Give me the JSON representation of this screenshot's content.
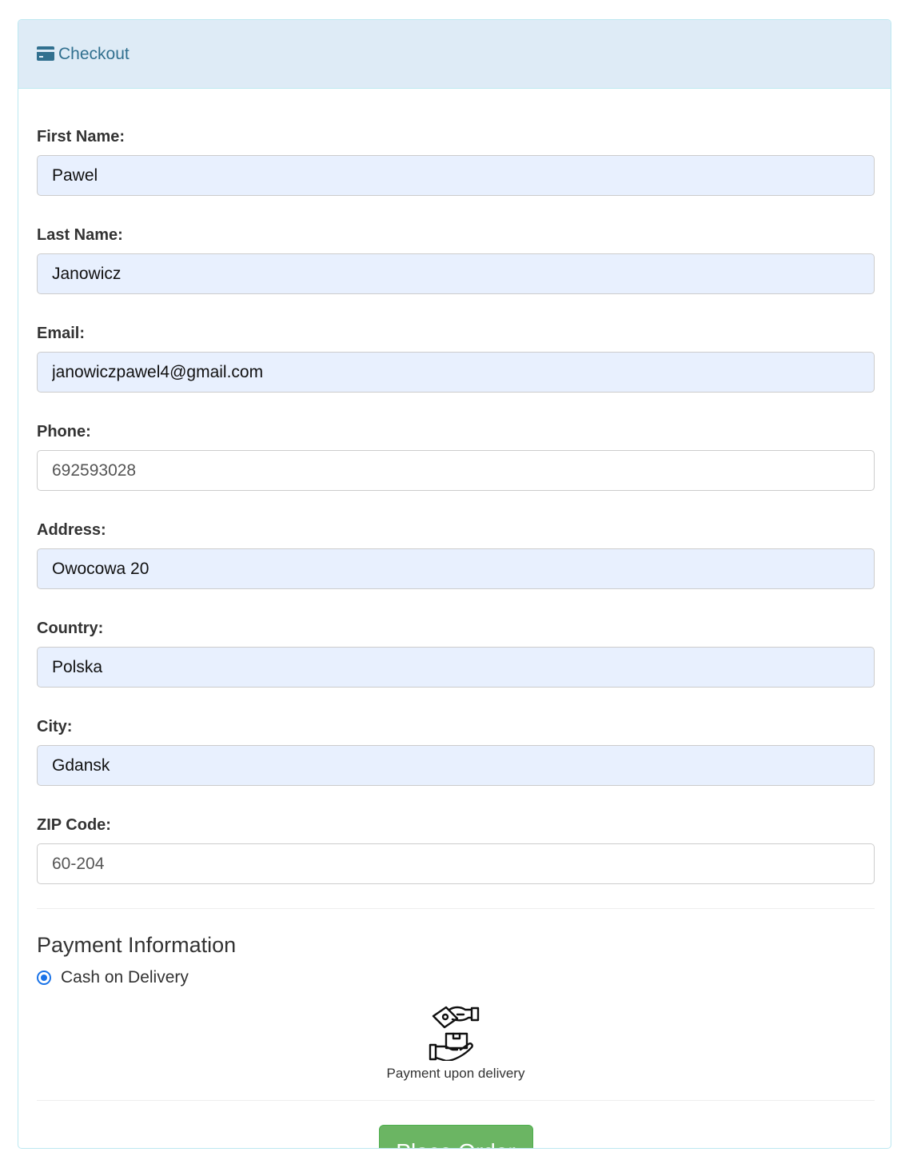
{
  "header": {
    "title": "Checkout",
    "icon": "credit-card-icon",
    "color": "#31708f",
    "background": "#deebf6"
  },
  "form": {
    "first_name": {
      "label": "First Name:",
      "value": "Pawel"
    },
    "last_name": {
      "label": "Last Name:",
      "value": "Janowicz"
    },
    "email": {
      "label": "Email:",
      "value": "janowiczpawel4@gmail.com"
    },
    "phone": {
      "label": "Phone:",
      "value": "692593028"
    },
    "address": {
      "label": "Address:",
      "value": "Owocowa 20"
    },
    "country": {
      "label": "Country:",
      "value": "Polska"
    },
    "city": {
      "label": "City:",
      "value": "Gdansk"
    },
    "zip": {
      "label": "ZIP Code:",
      "value": "60-204"
    }
  },
  "payment": {
    "title": "Payment Information",
    "option_label": "Cash on Delivery",
    "option_selected": true,
    "icon": "cash-on-delivery-icon",
    "caption": "Payment upon delivery"
  },
  "actions": {
    "place_order_label": "Place Order",
    "button_color": "#6bb563"
  }
}
